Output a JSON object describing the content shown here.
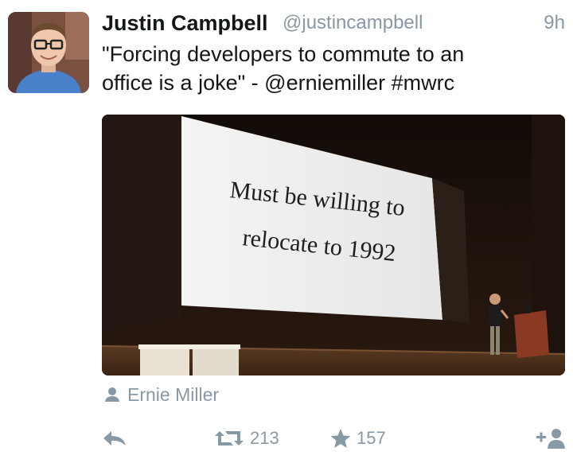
{
  "tweet": {
    "display_name": "Justin Campbell",
    "username": "@justincampbell",
    "timestamp": "9h",
    "text_line1": "\"Forcing developers to commute to an",
    "text_line2": "office is a joke\" - @erniemiller #mwrc"
  },
  "media": {
    "slide_line1": "Must be willing to",
    "slide_line2": "relocate to 1992"
  },
  "attribution": {
    "icon": "person-icon",
    "name": "Ernie Miller"
  },
  "actions": {
    "reply_icon": "reply-icon",
    "retweet_icon": "retweet-icon",
    "retweet_count": "213",
    "favorite_icon": "star-icon",
    "favorite_count": "157",
    "follow_icon": "follow-user-icon"
  },
  "colors": {
    "name": "#14171a",
    "secondary": "#8899a6"
  }
}
